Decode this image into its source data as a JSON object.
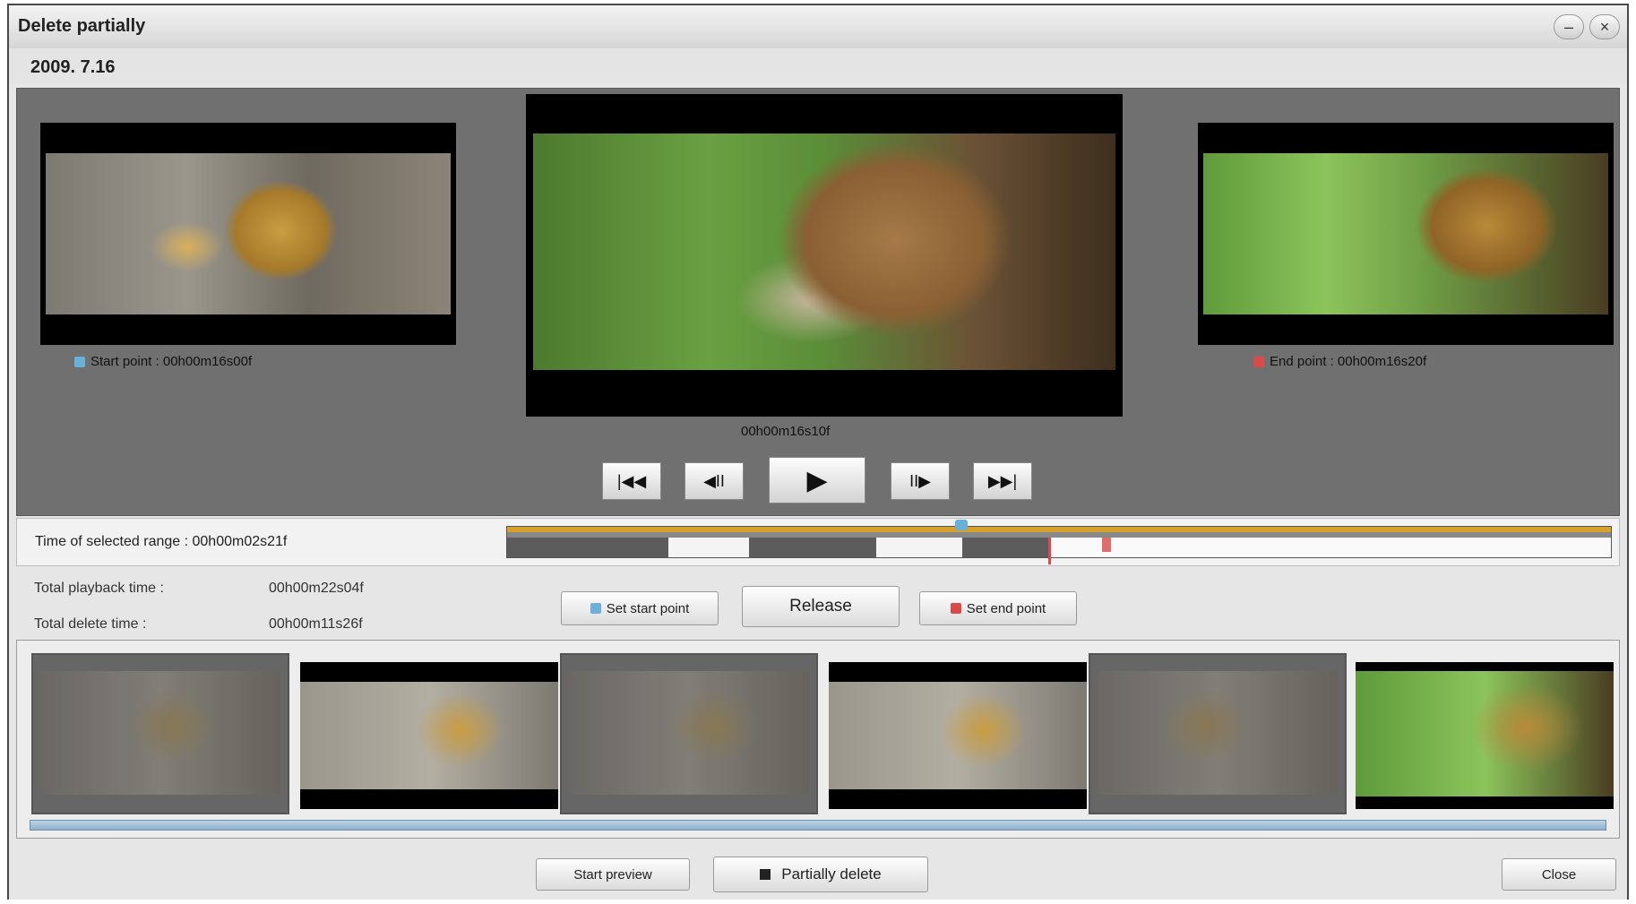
{
  "window": {
    "title": "Delete partially",
    "minimize_glyph": "–",
    "close_glyph": "×"
  },
  "subheader": {
    "date": "2009. 7.16"
  },
  "preview": {
    "start_caption": "Start point : 00h00m16s00f",
    "end_caption": "End point : 00h00m16s20f",
    "current_time": "00h00m16s10f"
  },
  "controls": {
    "first_label": "|◀◀",
    "prev_label": "◀II",
    "play_label": "▶",
    "next_label": "II▶",
    "last_label": "▶▶|"
  },
  "range": {
    "label": "Time of selected range : 00h00m02s21f"
  },
  "totals": {
    "playback_label": "Total playback time :",
    "playback_value": "00h00m22s04f",
    "delete_label": "Total delete time :",
    "delete_value": "00h00m11s26f"
  },
  "actions": {
    "set_start": "Set start point",
    "release": "Release",
    "set_end": "Set end point"
  },
  "filmstrip": {
    "frames": 6
  },
  "footer": {
    "start_preview": "Start preview",
    "partially_delete": "Partially delete",
    "close": "Close"
  },
  "colors": {
    "accent": "#d6a02c",
    "start_marker": "#6ab0d8",
    "end_marker": "#d94a4a",
    "panel": "#707070"
  },
  "icons": [
    "minimize-icon",
    "close-icon",
    "start-marker-icon",
    "end-marker-icon",
    "first-frame-icon",
    "step-back-icon",
    "play-icon",
    "step-forward-icon",
    "last-frame-icon",
    "stop-square-icon"
  ]
}
